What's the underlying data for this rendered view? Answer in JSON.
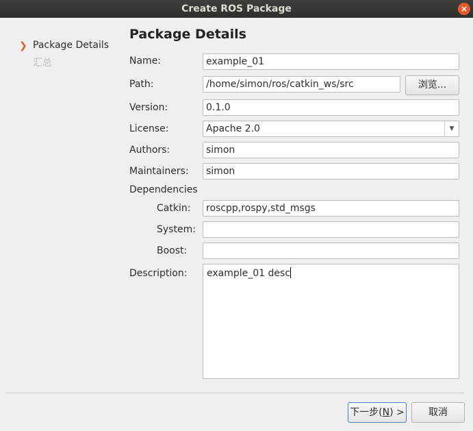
{
  "window": {
    "title": "Create ROS Package",
    "close_glyph": "×"
  },
  "nav": {
    "items": [
      {
        "label": "Package Details",
        "active": true
      },
      {
        "label": "汇总",
        "active": false
      }
    ]
  },
  "form": {
    "heading": "Package Details",
    "name": {
      "label": "Name:",
      "value": "example_01"
    },
    "path": {
      "label": "Path:",
      "value": "/home/simon/ros/catkin_ws/src",
      "browse_label": "浏览..."
    },
    "version": {
      "label": "Version:",
      "value": "0.1.0"
    },
    "license": {
      "label": "License:",
      "value": "Apache 2.0"
    },
    "authors": {
      "label": "Authors:",
      "value": "simon"
    },
    "maintainers": {
      "label": "Maintainers:",
      "value": "simon"
    },
    "dependencies": {
      "label": "Dependencies",
      "catkin": {
        "label": "Catkin:",
        "value": "roscpp,rospy,std_msgs"
      },
      "system": {
        "label": "System:",
        "value": ""
      },
      "boost": {
        "label": "Boost:",
        "value": ""
      }
    },
    "description": {
      "label": "Description:",
      "value": "example_01 desc"
    }
  },
  "footer": {
    "next_label_prefix": "下一步(",
    "next_mnemonic": "N",
    "next_label_suffix": ") >",
    "cancel_label": "取消"
  },
  "colors": {
    "accent": "#e05a2b",
    "titlebar": "#3a3936",
    "background": "#efefef"
  }
}
